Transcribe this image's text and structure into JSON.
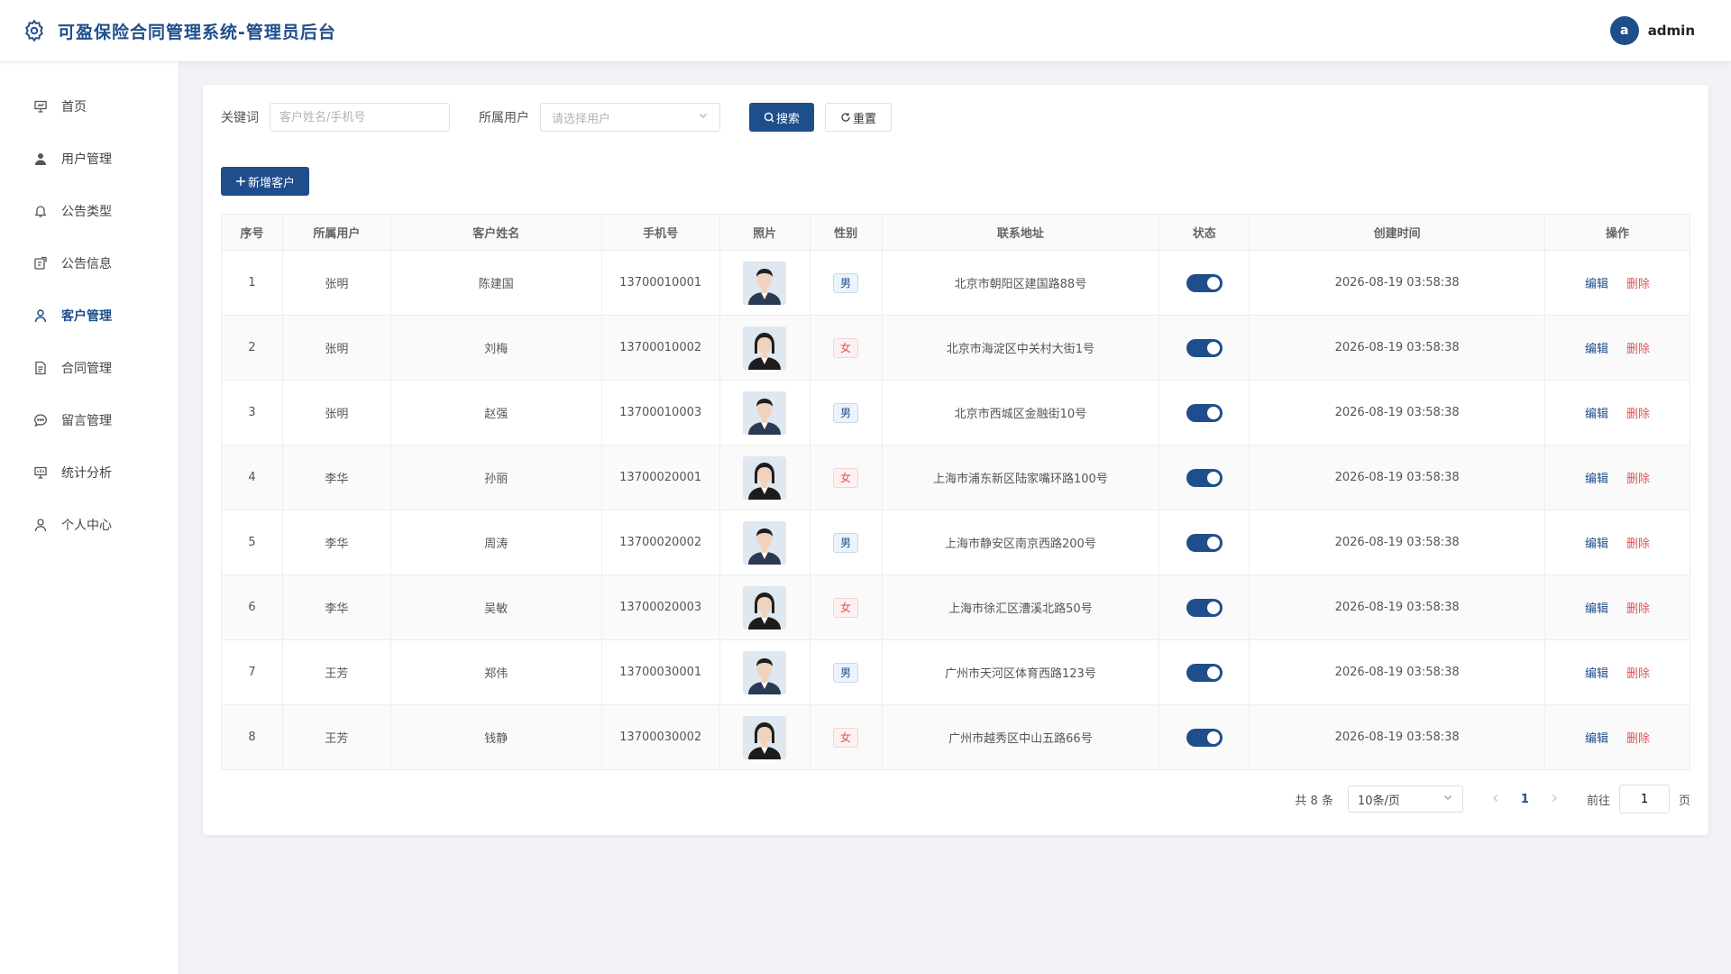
{
  "app": {
    "title": "可盈保险合同管理系统-管理员后台"
  },
  "user": {
    "avatar_letter": "a",
    "name": "admin"
  },
  "colors": {
    "primary": "#1f4e8c",
    "danger": "#e05454"
  },
  "sidebar": {
    "items": [
      {
        "label": "首页",
        "icon": "presentation-icon"
      },
      {
        "label": "用户管理",
        "icon": "user-filled-icon"
      },
      {
        "label": "公告类型",
        "icon": "bell-icon"
      },
      {
        "label": "公告信息",
        "icon": "notice-icon"
      },
      {
        "label": "客户管理",
        "icon": "user-icon",
        "active": true
      },
      {
        "label": "合同管理",
        "icon": "document-icon"
      },
      {
        "label": "留言管理",
        "icon": "chat-icon"
      },
      {
        "label": "统计分析",
        "icon": "chart-icon"
      },
      {
        "label": "个人中心",
        "icon": "user-icon"
      }
    ]
  },
  "filters": {
    "keyword_label": "关键词",
    "keyword_placeholder": "客户姓名/手机号",
    "owner_label": "所属用户",
    "owner_placeholder": "请选择用户",
    "search_label": "搜索",
    "reset_label": "重置"
  },
  "actions": {
    "add_label": "新增客户"
  },
  "table": {
    "columns": [
      "序号",
      "所属用户",
      "客户姓名",
      "手机号",
      "照片",
      "性别",
      "联系地址",
      "状态",
      "创建时间",
      "操作"
    ],
    "edit_label": "编辑",
    "delete_label": "删除",
    "rows": [
      {
        "no": "1",
        "owner": "张明",
        "name": "陈建国",
        "phone": "13700010001",
        "gender": "男",
        "address": "北京市朝阳区建国路88号",
        "status_on": true,
        "created": "2026-08-19 03:58:38"
      },
      {
        "no": "2",
        "owner": "张明",
        "name": "刘梅",
        "phone": "13700010002",
        "gender": "女",
        "address": "北京市海淀区中关村大街1号",
        "status_on": true,
        "created": "2026-08-19 03:58:38"
      },
      {
        "no": "3",
        "owner": "张明",
        "name": "赵强",
        "phone": "13700010003",
        "gender": "男",
        "address": "北京市西城区金融街10号",
        "status_on": true,
        "created": "2026-08-19 03:58:38"
      },
      {
        "no": "4",
        "owner": "李华",
        "name": "孙丽",
        "phone": "13700020001",
        "gender": "女",
        "address": "上海市浦东新区陆家嘴环路100号",
        "status_on": true,
        "created": "2026-08-19 03:58:38"
      },
      {
        "no": "5",
        "owner": "李华",
        "name": "周涛",
        "phone": "13700020002",
        "gender": "男",
        "address": "上海市静安区南京西路200号",
        "status_on": true,
        "created": "2026-08-19 03:58:38"
      },
      {
        "no": "6",
        "owner": "李华",
        "name": "吴敏",
        "phone": "13700020003",
        "gender": "女",
        "address": "上海市徐汇区漕溪北路50号",
        "status_on": true,
        "created": "2026-08-19 03:58:38"
      },
      {
        "no": "7",
        "owner": "王芳",
        "name": "郑伟",
        "phone": "13700030001",
        "gender": "男",
        "address": "广州市天河区体育西路123号",
        "status_on": true,
        "created": "2026-08-19 03:58:38"
      },
      {
        "no": "8",
        "owner": "王芳",
        "name": "钱静",
        "phone": "13700030002",
        "gender": "女",
        "address": "广州市越秀区中山五路66号",
        "status_on": true,
        "created": "2026-08-19 03:58:38"
      }
    ]
  },
  "pagination": {
    "total_text": "共 8 条",
    "page_size": "10条/页",
    "current_page": "1",
    "goto_label": "前往",
    "goto_value": "1",
    "page_suffix": "页"
  }
}
